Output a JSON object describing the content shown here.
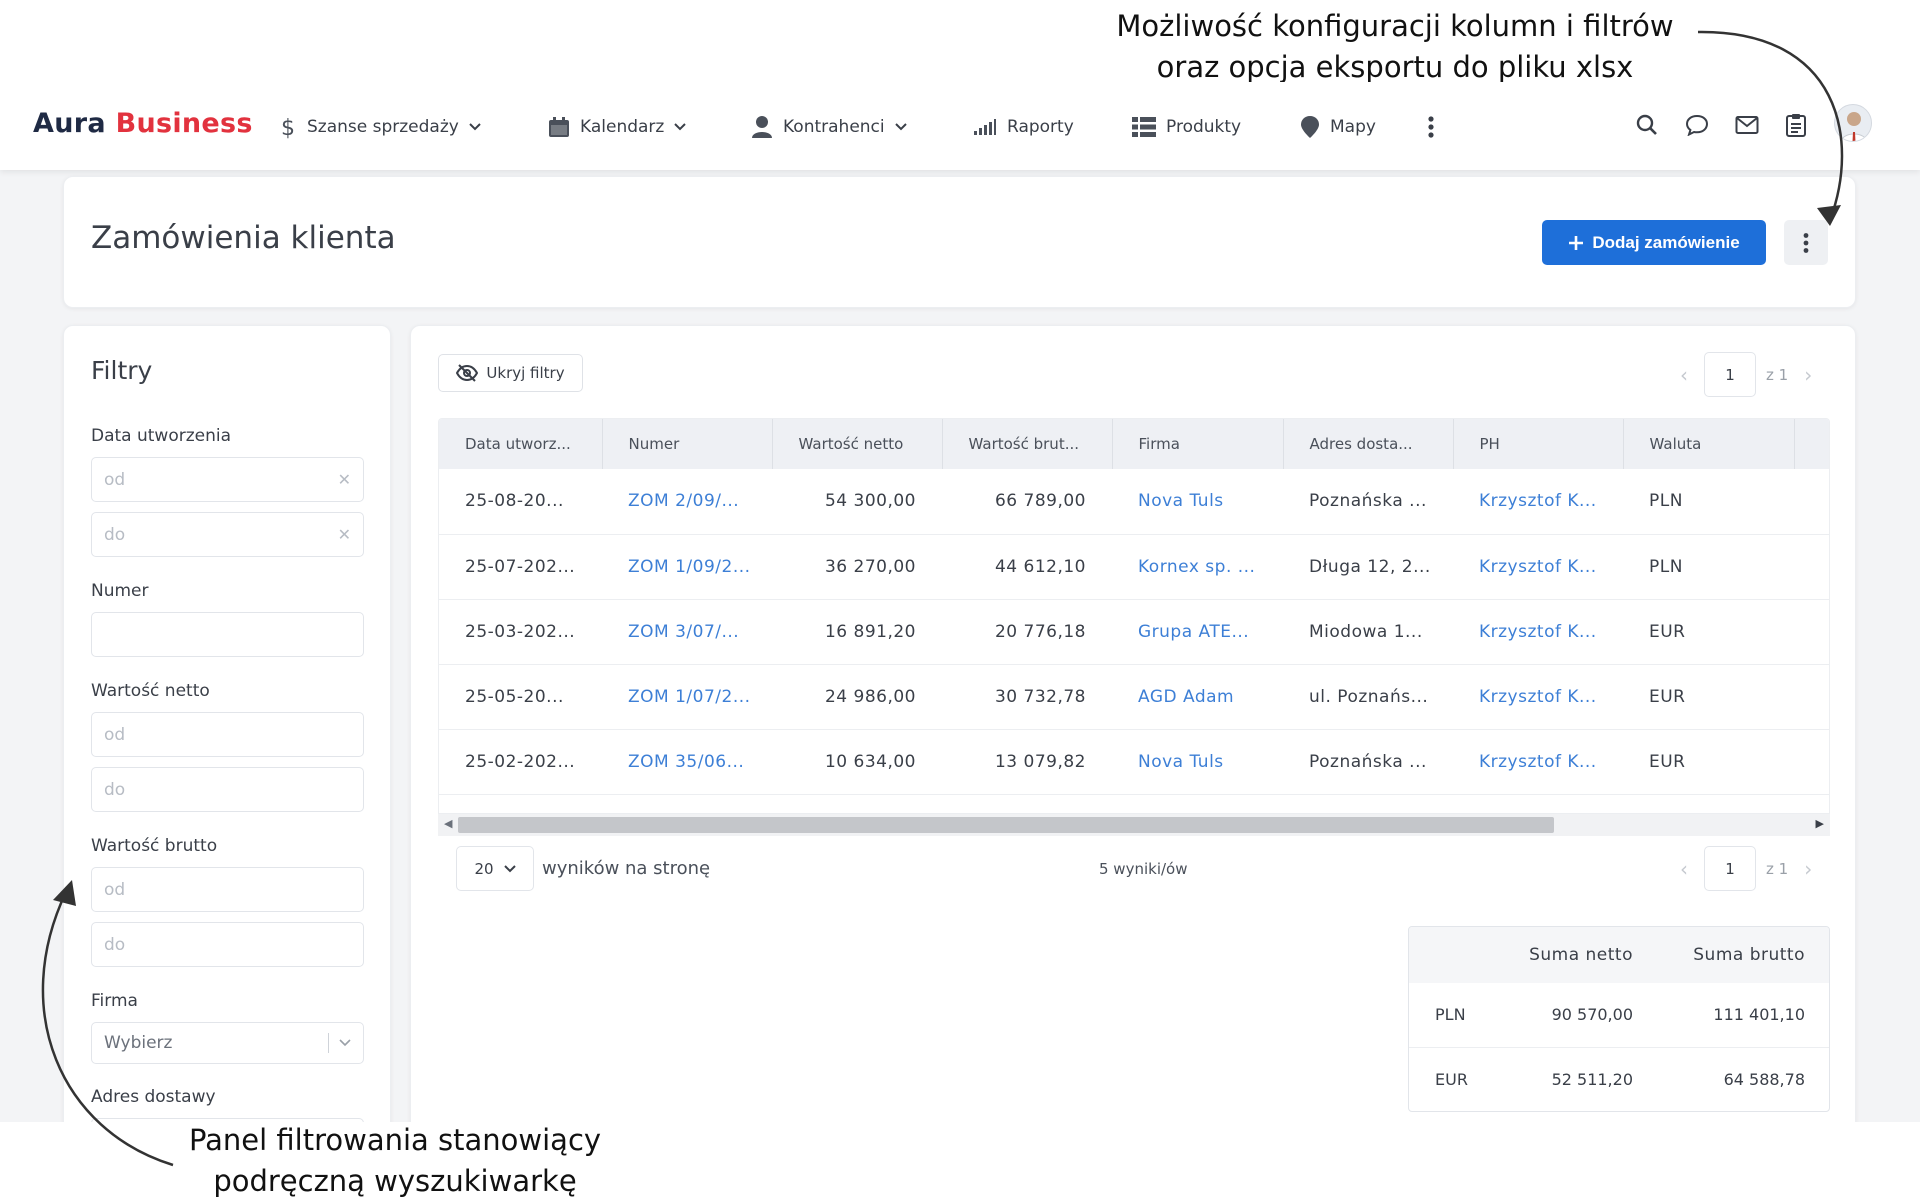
{
  "annotations": {
    "top_line1": "Możliwość konfiguracji kolumn i filtrów",
    "top_line2": "oraz opcja eksportu do pliku xlsx",
    "bottom_line1": "Panel filtrowania stanowiący",
    "bottom_line2": "podręczną wyszukiwarkę"
  },
  "brand": {
    "part1": "Aura",
    "part2": "Business"
  },
  "nav": {
    "items": [
      {
        "label": "Szanse sprzedaży",
        "icon": "dollar-icon",
        "dropdown": true
      },
      {
        "label": "Kalendarz",
        "icon": "calendar-icon",
        "dropdown": true
      },
      {
        "label": "Kontrahenci",
        "icon": "person-icon",
        "dropdown": true
      },
      {
        "label": "Raporty",
        "icon": "signal-bars-icon",
        "dropdown": false
      },
      {
        "label": "Produkty",
        "icon": "grid-list-icon",
        "dropdown": false
      },
      {
        "label": "Mapy",
        "icon": "map-pin-icon",
        "dropdown": false
      }
    ],
    "right_icons": [
      "search-icon",
      "chat-icon",
      "mail-icon",
      "clipboard-icon"
    ]
  },
  "header": {
    "title": "Zamówienia klienta",
    "add_button": "Dodaj zamówienie"
  },
  "filters": {
    "title": "Filtry",
    "date_created": {
      "label": "Data utworzenia",
      "from_placeholder": "od",
      "to_placeholder": "do"
    },
    "number": {
      "label": "Numer",
      "value": ""
    },
    "net_value": {
      "label": "Wartość netto",
      "from_placeholder": "od",
      "to_placeholder": "do"
    },
    "gross_value": {
      "label": "Wartość brutto",
      "from_placeholder": "od",
      "to_placeholder": "do"
    },
    "company": {
      "label": "Firma",
      "placeholder": "Wybierz"
    },
    "delivery_address": {
      "label": "Adres dostawy"
    }
  },
  "toolbar": {
    "hide_filters": "Ukryj filtry"
  },
  "pagination": {
    "current_page": "1",
    "of_label": "z 1"
  },
  "table": {
    "columns": [
      "Data utworz...",
      "Numer",
      "Wartość netto",
      "Wartość brut...",
      "Firma",
      "Adres dosta...",
      "PH",
      "Waluta"
    ],
    "rows": [
      [
        "25-08-20...",
        "ZOM 2/09/...",
        "54 300,00",
        "66 789,00",
        "Nova Tuls",
        "Poznańska ...",
        "Krzysztof K...",
        "PLN"
      ],
      [
        "25-07-202...",
        "ZOM 1/09/2...",
        "36 270,00",
        "44 612,10",
        "Kornex sp. ...",
        "Długa 12, 2...",
        "Krzysztof K...",
        "PLN"
      ],
      [
        "25-03-202...",
        "ZOM 3/07/...",
        "16 891,20",
        "20 776,18",
        "Grupa ATE...",
        "Miodowa 1...",
        "Krzysztof K...",
        "EUR"
      ],
      [
        "25-05-20...",
        "ZOM 1/07/2...",
        "24 986,00",
        "30 732,78",
        "AGD Adam",
        "ul. Poznańs...",
        "Krzysztof K...",
        "EUR"
      ],
      [
        "25-02-202...",
        "ZOM 35/06...",
        "10 634,00",
        "13 079,82",
        "Nova Tuls",
        "Poznańska ...",
        "Krzysztof K...",
        "EUR"
      ]
    ]
  },
  "footer": {
    "per_page": "20",
    "per_page_label": "wyników na stronę",
    "results_count": "5 wyniki/ów"
  },
  "summary": {
    "headers": [
      "Suma netto",
      "Suma brutto"
    ],
    "rows": [
      [
        "PLN",
        "90 570,00",
        "111 401,10"
      ],
      [
        "EUR",
        "52 511,20",
        "64 588,78"
      ]
    ]
  },
  "colors": {
    "brand_dark": "#1f2a44",
    "brand_red": "#e2323e",
    "primary": "#1e6fd9",
    "link": "#3d7fd6"
  }
}
